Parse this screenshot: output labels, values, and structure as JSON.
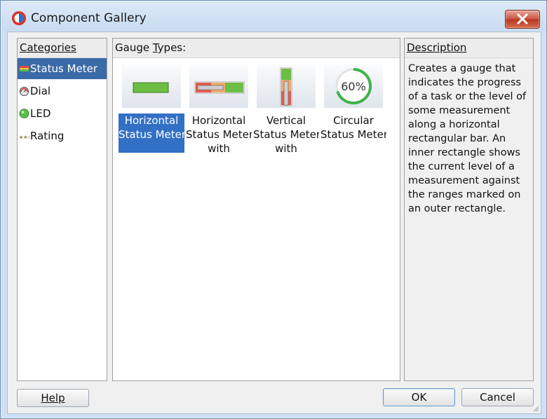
{
  "window": {
    "title": "Component Gallery",
    "close_icon": "close-icon"
  },
  "categories": {
    "header": "Categories",
    "items": [
      {
        "label": "Status Meter",
        "icon": "status-meter-icon",
        "selected": true
      },
      {
        "label": "Dial",
        "icon": "dial-icon",
        "selected": false
      },
      {
        "label": "LED",
        "icon": "led-icon",
        "selected": false
      },
      {
        "label": "Rating",
        "icon": "rating-icon",
        "selected": false
      }
    ]
  },
  "gauge_types": {
    "header": "Gauge Types:",
    "items": [
      {
        "lines": [
          "Horizontal",
          "Status Meter"
        ],
        "selected": true
      },
      {
        "lines": [
          "Horizontal",
          "Status Meter",
          "with"
        ],
        "selected": false
      },
      {
        "lines": [
          "Vertical",
          "Status Meter",
          "with"
        ],
        "selected": false
      },
      {
        "lines": [
          "Circular",
          "Status Meter"
        ],
        "selected": false,
        "thumb_text": "60%"
      }
    ]
  },
  "description": {
    "header": "Description",
    "lines": [
      "Creates a gauge that",
      "indicates the progress",
      "of a task or the level of",
      "some measurement",
      "along a horizontal",
      "rectangular bar. An",
      "inner rectangle shows",
      "the current level of a",
      "measurement against",
      "the ranges marked on",
      "an outer rectangle."
    ]
  },
  "buttons": {
    "help": "Help",
    "ok": "OK",
    "cancel": "Cancel"
  },
  "colors": {
    "selection": "#3270c5",
    "accent_green": "#6cbf44",
    "close_red": "#c8533e"
  }
}
